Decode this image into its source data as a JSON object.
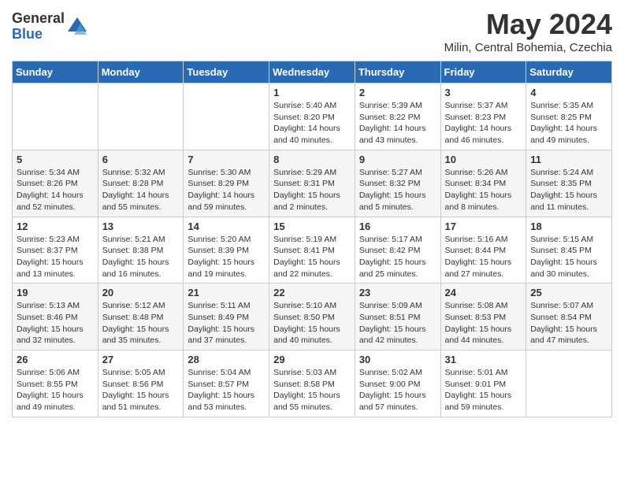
{
  "logo": {
    "general": "General",
    "blue": "Blue"
  },
  "title": "May 2024",
  "location": "Milin, Central Bohemia, Czechia",
  "days_of_week": [
    "Sunday",
    "Monday",
    "Tuesday",
    "Wednesday",
    "Thursday",
    "Friday",
    "Saturday"
  ],
  "weeks": [
    [
      {
        "day": "",
        "info": ""
      },
      {
        "day": "",
        "info": ""
      },
      {
        "day": "",
        "info": ""
      },
      {
        "day": "1",
        "info": "Sunrise: 5:40 AM\nSunset: 8:20 PM\nDaylight: 14 hours\nand 40 minutes."
      },
      {
        "day": "2",
        "info": "Sunrise: 5:39 AM\nSunset: 8:22 PM\nDaylight: 14 hours\nand 43 minutes."
      },
      {
        "day": "3",
        "info": "Sunrise: 5:37 AM\nSunset: 8:23 PM\nDaylight: 14 hours\nand 46 minutes."
      },
      {
        "day": "4",
        "info": "Sunrise: 5:35 AM\nSunset: 8:25 PM\nDaylight: 14 hours\nand 49 minutes."
      }
    ],
    [
      {
        "day": "5",
        "info": "Sunrise: 5:34 AM\nSunset: 8:26 PM\nDaylight: 14 hours\nand 52 minutes."
      },
      {
        "day": "6",
        "info": "Sunrise: 5:32 AM\nSunset: 8:28 PM\nDaylight: 14 hours\nand 55 minutes."
      },
      {
        "day": "7",
        "info": "Sunrise: 5:30 AM\nSunset: 8:29 PM\nDaylight: 14 hours\nand 59 minutes."
      },
      {
        "day": "8",
        "info": "Sunrise: 5:29 AM\nSunset: 8:31 PM\nDaylight: 15 hours\nand 2 minutes."
      },
      {
        "day": "9",
        "info": "Sunrise: 5:27 AM\nSunset: 8:32 PM\nDaylight: 15 hours\nand 5 minutes."
      },
      {
        "day": "10",
        "info": "Sunrise: 5:26 AM\nSunset: 8:34 PM\nDaylight: 15 hours\nand 8 minutes."
      },
      {
        "day": "11",
        "info": "Sunrise: 5:24 AM\nSunset: 8:35 PM\nDaylight: 15 hours\nand 11 minutes."
      }
    ],
    [
      {
        "day": "12",
        "info": "Sunrise: 5:23 AM\nSunset: 8:37 PM\nDaylight: 15 hours\nand 13 minutes."
      },
      {
        "day": "13",
        "info": "Sunrise: 5:21 AM\nSunset: 8:38 PM\nDaylight: 15 hours\nand 16 minutes."
      },
      {
        "day": "14",
        "info": "Sunrise: 5:20 AM\nSunset: 8:39 PM\nDaylight: 15 hours\nand 19 minutes."
      },
      {
        "day": "15",
        "info": "Sunrise: 5:19 AM\nSunset: 8:41 PM\nDaylight: 15 hours\nand 22 minutes."
      },
      {
        "day": "16",
        "info": "Sunrise: 5:17 AM\nSunset: 8:42 PM\nDaylight: 15 hours\nand 25 minutes."
      },
      {
        "day": "17",
        "info": "Sunrise: 5:16 AM\nSunset: 8:44 PM\nDaylight: 15 hours\nand 27 minutes."
      },
      {
        "day": "18",
        "info": "Sunrise: 5:15 AM\nSunset: 8:45 PM\nDaylight: 15 hours\nand 30 minutes."
      }
    ],
    [
      {
        "day": "19",
        "info": "Sunrise: 5:13 AM\nSunset: 8:46 PM\nDaylight: 15 hours\nand 32 minutes."
      },
      {
        "day": "20",
        "info": "Sunrise: 5:12 AM\nSunset: 8:48 PM\nDaylight: 15 hours\nand 35 minutes."
      },
      {
        "day": "21",
        "info": "Sunrise: 5:11 AM\nSunset: 8:49 PM\nDaylight: 15 hours\nand 37 minutes."
      },
      {
        "day": "22",
        "info": "Sunrise: 5:10 AM\nSunset: 8:50 PM\nDaylight: 15 hours\nand 40 minutes."
      },
      {
        "day": "23",
        "info": "Sunrise: 5:09 AM\nSunset: 8:51 PM\nDaylight: 15 hours\nand 42 minutes."
      },
      {
        "day": "24",
        "info": "Sunrise: 5:08 AM\nSunset: 8:53 PM\nDaylight: 15 hours\nand 44 minutes."
      },
      {
        "day": "25",
        "info": "Sunrise: 5:07 AM\nSunset: 8:54 PM\nDaylight: 15 hours\nand 47 minutes."
      }
    ],
    [
      {
        "day": "26",
        "info": "Sunrise: 5:06 AM\nSunset: 8:55 PM\nDaylight: 15 hours\nand 49 minutes."
      },
      {
        "day": "27",
        "info": "Sunrise: 5:05 AM\nSunset: 8:56 PM\nDaylight: 15 hours\nand 51 minutes."
      },
      {
        "day": "28",
        "info": "Sunrise: 5:04 AM\nSunset: 8:57 PM\nDaylight: 15 hours\nand 53 minutes."
      },
      {
        "day": "29",
        "info": "Sunrise: 5:03 AM\nSunset: 8:58 PM\nDaylight: 15 hours\nand 55 minutes."
      },
      {
        "day": "30",
        "info": "Sunrise: 5:02 AM\nSunset: 9:00 PM\nDaylight: 15 hours\nand 57 minutes."
      },
      {
        "day": "31",
        "info": "Sunrise: 5:01 AM\nSunset: 9:01 PM\nDaylight: 15 hours\nand 59 minutes."
      },
      {
        "day": "",
        "info": ""
      }
    ]
  ]
}
